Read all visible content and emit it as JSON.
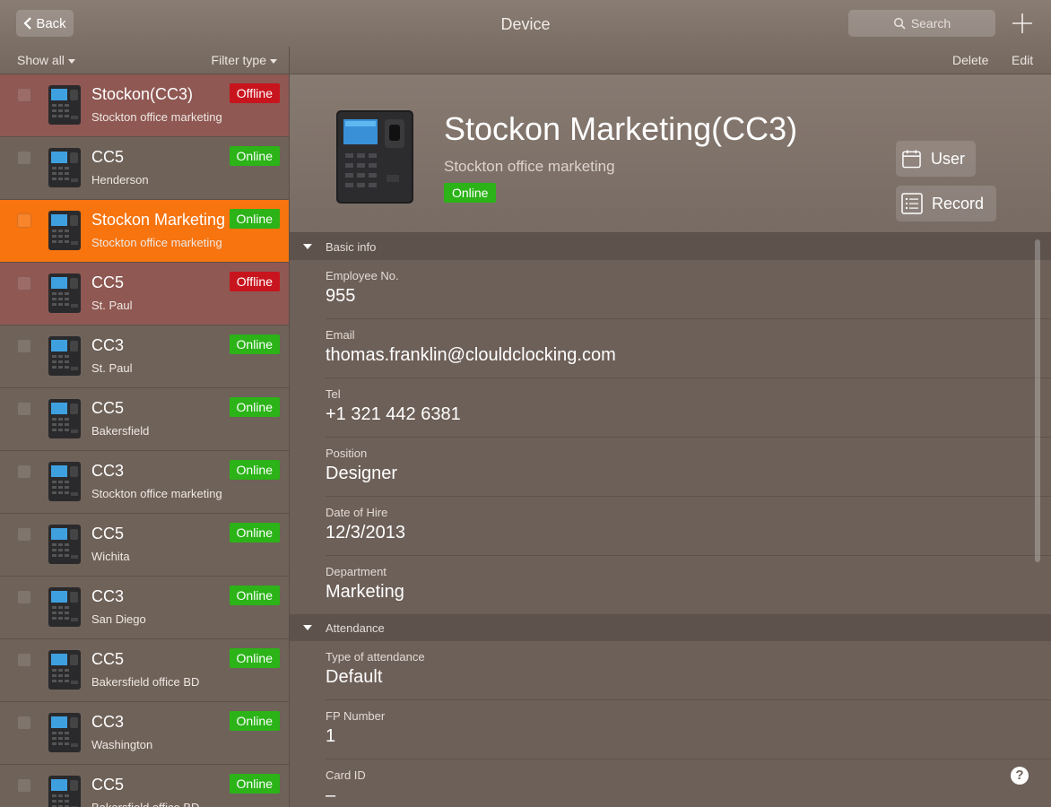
{
  "header": {
    "back_label": "Back",
    "title": "Device",
    "search_placeholder": "Search"
  },
  "list": {
    "show_all": "Show all",
    "filter_type": "Filter type",
    "items": [
      {
        "name": "Stockon(CC3)",
        "location": "Stockton office marketing",
        "status": "Offline",
        "state": "offline"
      },
      {
        "name": "CC5",
        "location": "Henderson",
        "status": "Online",
        "state": "online"
      },
      {
        "name": "Stockon Marketing",
        "location": "Stockton office marketing",
        "status": "Online",
        "state": "selected"
      },
      {
        "name": "CC5",
        "location": "St. Paul",
        "status": "Offline",
        "state": "offline"
      },
      {
        "name": "CC3",
        "location": "St. Paul",
        "status": "Online",
        "state": "online"
      },
      {
        "name": "CC5",
        "location": "Bakersfield",
        "status": "Online",
        "state": "online"
      },
      {
        "name": "CC3",
        "location": "Stockton office marketing",
        "status": "Online",
        "state": "online"
      },
      {
        "name": "CC5",
        "location": "Wichita",
        "status": "Online",
        "state": "online"
      },
      {
        "name": "CC3",
        "location": "San Diego",
        "status": "Online",
        "state": "online"
      },
      {
        "name": "CC5",
        "location": "Bakersfield office BD",
        "status": "Online",
        "state": "online"
      },
      {
        "name": "CC3",
        "location": "Washington",
        "status": "Online",
        "state": "online"
      },
      {
        "name": "CC5",
        "location": "Bakersfield office BD",
        "status": "Online",
        "state": "online"
      }
    ]
  },
  "detail": {
    "delete_label": "Delete",
    "edit_label": "Edit",
    "title": "Stockon Marketing(CC3)",
    "subtitle": "Stockton office marketing",
    "status": "Online",
    "user_btn": "User",
    "record_btn": "Record",
    "basic_info": {
      "heading": "Basic info",
      "fields": [
        {
          "label": "Employee No.",
          "value": "955"
        },
        {
          "label": "Email",
          "value": "thomas.franklin@clouldclocking.com"
        },
        {
          "label": "Tel",
          "value": "+1 321 442 6381"
        },
        {
          "label": "Position",
          "value": "Designer"
        },
        {
          "label": "Date of Hire",
          "value": "12/3/2013"
        },
        {
          "label": "Department",
          "value": "Marketing"
        }
      ]
    },
    "attendance": {
      "heading": "Attendance",
      "fields": [
        {
          "label": "Type of attendance",
          "value": "Default"
        },
        {
          "label": "FP Number",
          "value": "1"
        },
        {
          "label": "Card ID",
          "value": "–"
        }
      ]
    }
  },
  "help_label": "?",
  "colors": {
    "online": "#2bb318",
    "offline": "#c8141d",
    "selected": "#f7740f"
  }
}
